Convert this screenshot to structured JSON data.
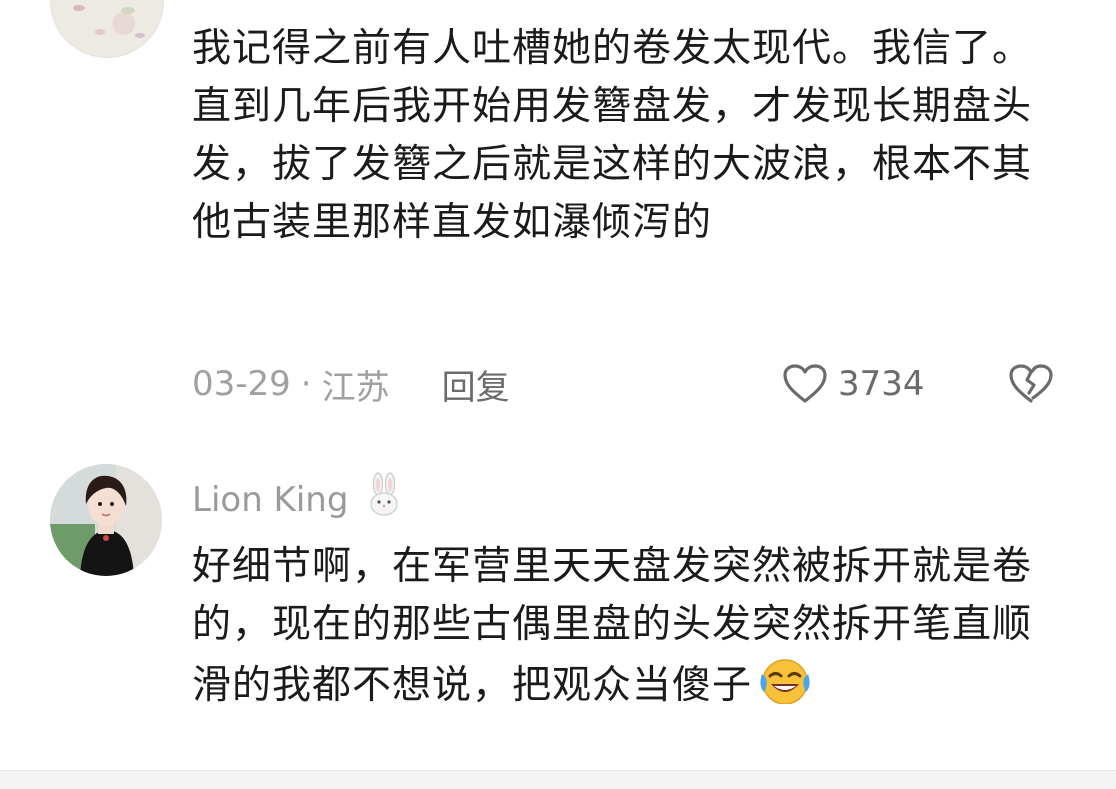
{
  "comments": [
    {
      "text": "我记得之前有人吐槽她的卷发太现代。我信了。直到几年后我开始用发簪盘发，才发现长期盘头发，拔了发簪之后就是这样的大波浪，根本不其他古装里那样直发如瀑倾泻的",
      "date": "03-29",
      "separator": "·",
      "location": "江苏",
      "reply_label": "回复",
      "likes": "3734",
      "icons": {
        "like": "heart-outline-icon",
        "dislike": "broken-heart-icon"
      }
    },
    {
      "username": "Lion King",
      "badge_icon": "bunny-badge-icon",
      "text": "好细节啊，在军营里天天盘发突然被拆开就是卷的，现在的那些古偶里盘的头发突然拆开笔直顺滑的我都不想说，把观众当傻子",
      "emoji_icon": "face-with-tears-of-joy-emoji"
    }
  ],
  "colors": {
    "text": "#1b1b1b",
    "meta": "#a0a0a0",
    "action": "#6b6b6b"
  }
}
